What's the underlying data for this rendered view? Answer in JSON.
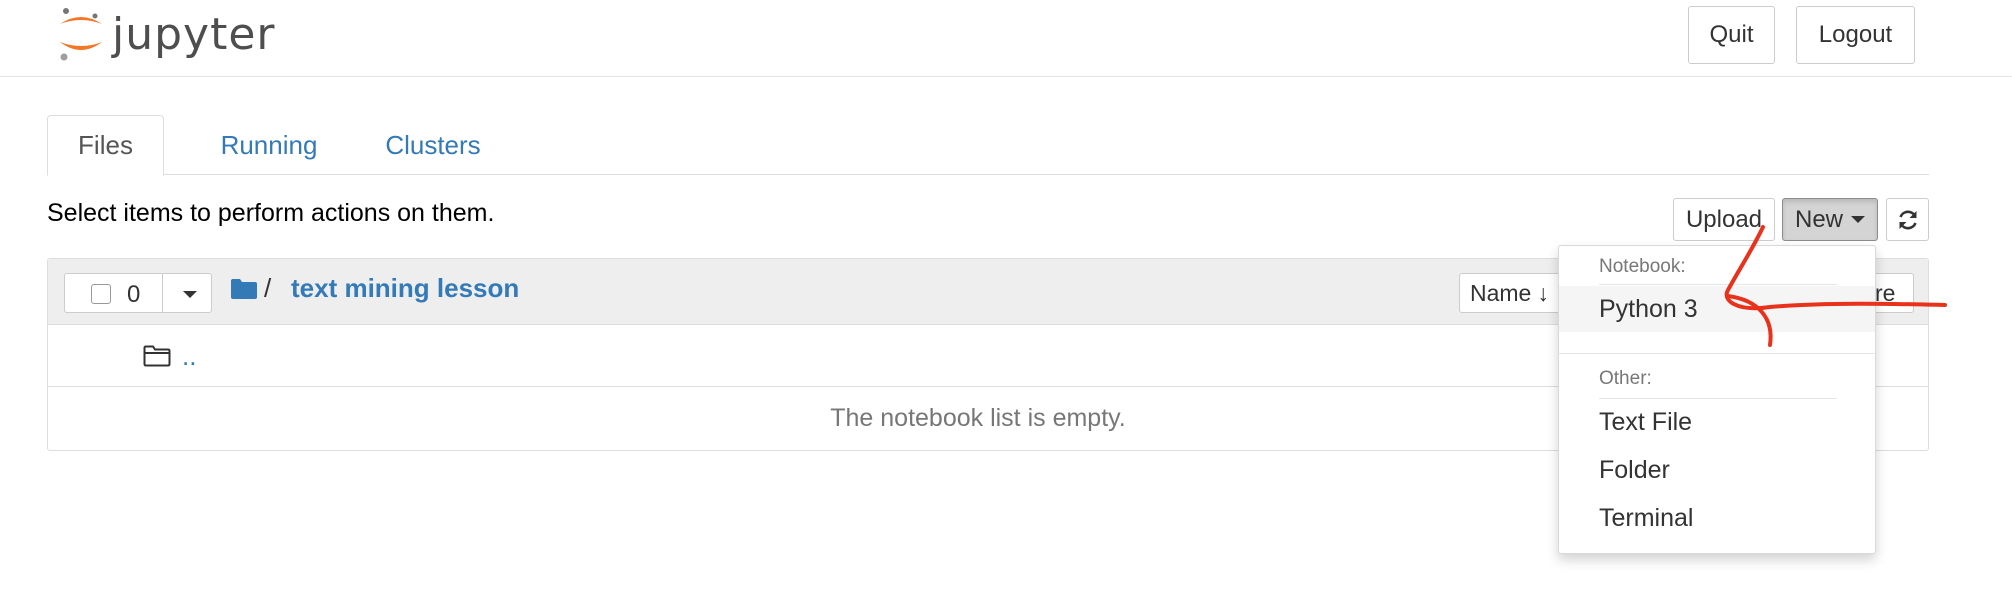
{
  "header": {
    "logo_text": "jupyter",
    "quit_label": "Quit",
    "logout_label": "Logout"
  },
  "tabs": [
    {
      "label": "Files",
      "active": true
    },
    {
      "label": "Running",
      "active": false
    },
    {
      "label": "Clusters",
      "active": false
    }
  ],
  "toolbar": {
    "hint": "Select items to perform actions on them.",
    "upload_label": "Upload",
    "new_label": "New"
  },
  "list": {
    "selected_count": "0",
    "breadcrumb_separator": "/",
    "breadcrumb_folder": "text mining lesson",
    "sort_name_label": "Name",
    "sort_name_arrow": "↓",
    "sort_second_label_partial": "re",
    "up_dir_label": "..",
    "empty_message": "The notebook list is empty."
  },
  "new_menu": {
    "notebook_header": "Notebook:",
    "notebook_items": [
      "Python 3"
    ],
    "other_header": "Other:",
    "other_items": [
      "Text File",
      "Folder",
      "Terminal"
    ]
  },
  "colors": {
    "link": "#337ab7",
    "logo_orange": "#f37726",
    "annotation_red": "#e8321c"
  }
}
